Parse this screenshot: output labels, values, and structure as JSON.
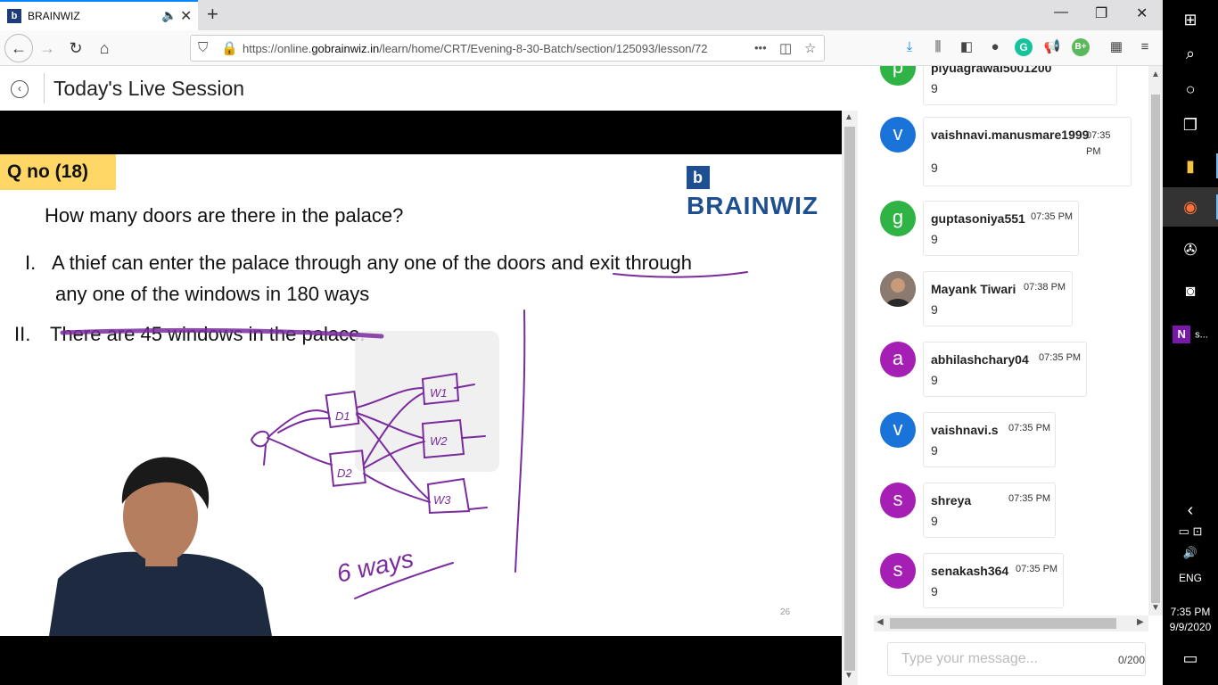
{
  "browser": {
    "tab_title": "BRAINWIZ",
    "tab_favicon": "b",
    "url_prefix": "https://online.",
    "url_domain": "gobrainwiz.in",
    "url_path": "/learn/home/CRT/Evening-8-30-Batch/section/125093/lesson/72",
    "url_more": "•••"
  },
  "page": {
    "title": "Today's Live Session"
  },
  "slide": {
    "qno": "Q no (18)",
    "brand": "BRAINWIZ",
    "question": "How many doors are there in the palace?",
    "s1_num": "I.",
    "s1_line1": "A thief can enter the palace through any one of the doors and exit through",
    "s1_line2": "any one of the windows in 180 ways",
    "s2_num": "II.",
    "s2_text": "There are 45 windows in the palace.",
    "annot_ways": "6 ways",
    "annot_d1": "D1",
    "annot_d2": "D2",
    "annot_w1": "W1",
    "annot_w2": "W2",
    "annot_w3": "W3",
    "page_number": "26"
  },
  "chat": {
    "messages": [
      {
        "initial": "p",
        "color": "#2fb344",
        "user": "piyuagrawal5001200",
        "time": "",
        "text": "9"
      },
      {
        "initial": "v",
        "color": "#1a73d9",
        "user": "vaishnavi.manusmare1999",
        "time": "07:35 PM",
        "text": "9"
      },
      {
        "initial": "g",
        "color": "#2fb344",
        "user": "guptasoniya551",
        "time": "07:35 PM",
        "text": "9"
      },
      {
        "initial": "",
        "color": "#6b5b4e",
        "user": "Mayank Tiwari",
        "time": "07:38 PM",
        "text": "9"
      },
      {
        "initial": "a",
        "color": "#a51fb5",
        "user": "abhilashchary04",
        "time": "07:35 PM",
        "text": "9"
      },
      {
        "initial": "v",
        "color": "#1a73d9",
        "user": "vaishnavi.s",
        "time": "07:35 PM",
        "text": "9"
      },
      {
        "initial": "s",
        "color": "#a51fb5",
        "user": "shreya",
        "time": "07:35 PM",
        "text": "9"
      },
      {
        "initial": "s",
        "color": "#a51fb5",
        "user": "senakash364",
        "time": "07:35 PM",
        "text": "9"
      }
    ],
    "input_placeholder": "Type your message...",
    "char_count": "0/200"
  },
  "taskbar": {
    "onenote_label": "s...",
    "language": "ENG",
    "time": "7:35 PM",
    "date": "9/9/2020"
  },
  "icons": {
    "windows": "⊞",
    "search": "⌕",
    "cortana": "○",
    "taskview": "❐",
    "explorer": "▮",
    "firefox": "◉",
    "recorder": "✇",
    "camera": "◙",
    "onenote": "N",
    "chevron": "‹",
    "notifications": "▭"
  }
}
